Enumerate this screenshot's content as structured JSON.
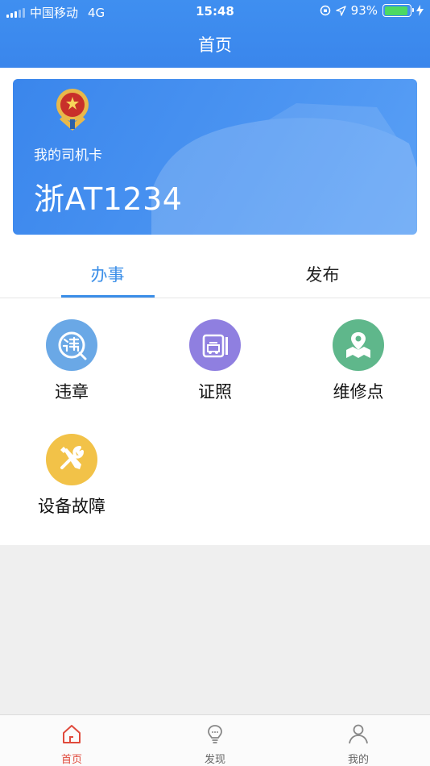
{
  "status_bar": {
    "carrier": "中国移动",
    "network": "4G",
    "time": "15:48",
    "battery": "93%",
    "battery_level": 0.93
  },
  "header": {
    "title": "首页"
  },
  "driver_card": {
    "caption": "我的司机卡",
    "plate": "浙AT1234"
  },
  "tabs": [
    {
      "label": "办事",
      "active": true
    },
    {
      "label": "发布",
      "active": false
    }
  ],
  "services": [
    {
      "label": "违章",
      "icon": "violation-icon",
      "color": "#6aa8e6"
    },
    {
      "label": "证照",
      "icon": "license-icon",
      "color": "#8f7fe0"
    },
    {
      "label": "维修点",
      "icon": "repair-location-icon",
      "color": "#5fb78b"
    },
    {
      "label": "设备故障",
      "icon": "tools-icon",
      "color": "#f2c248"
    }
  ],
  "bottom_nav": [
    {
      "label": "首页",
      "icon": "home-icon",
      "active": true
    },
    {
      "label": "发现",
      "icon": "lightbulb-icon",
      "active": false
    },
    {
      "label": "我的",
      "icon": "user-icon",
      "active": false
    }
  ],
  "colors": {
    "primary": "#3a8ee8",
    "active_nav": "#e04a3c"
  }
}
